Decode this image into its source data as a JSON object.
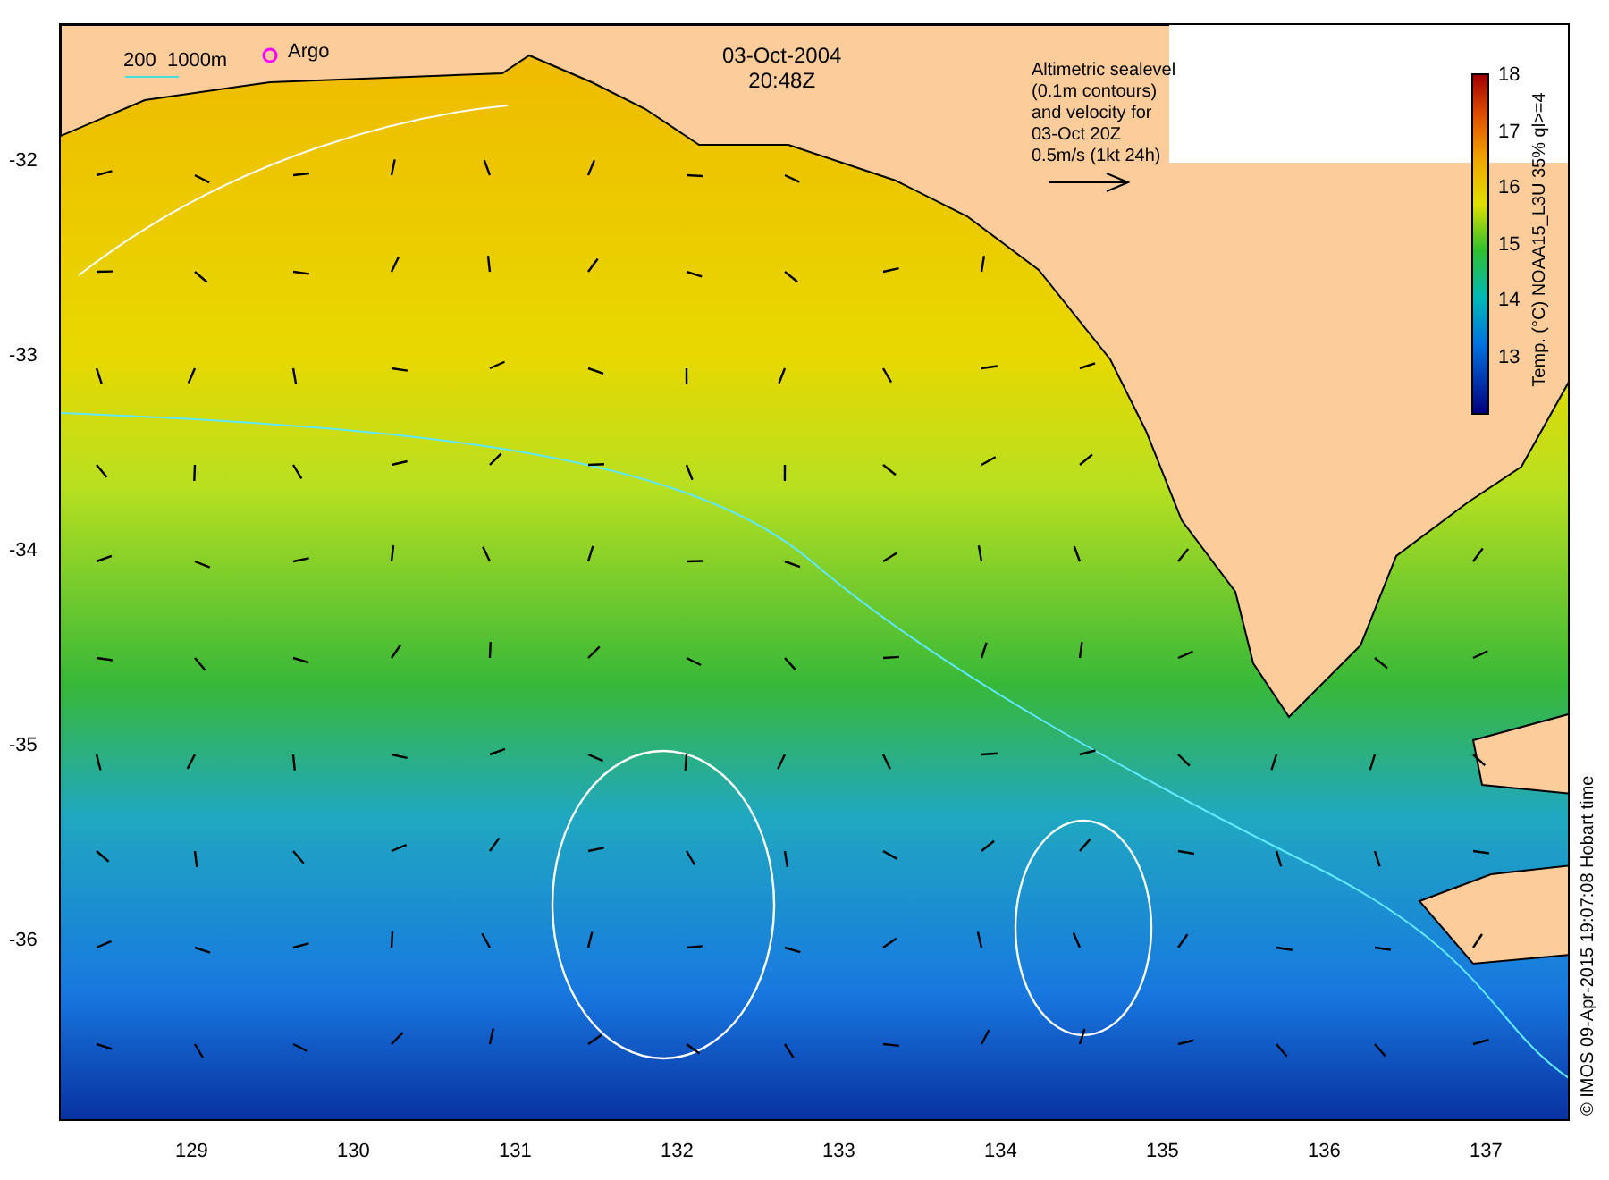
{
  "map": {
    "date": "03-Oct-2004",
    "time": "20:48Z",
    "scale_label": "200  1000m",
    "argo_label": "Argo",
    "legend": [
      "Altimetric sealevel",
      "(0.1m contours)",
      "and velocity for",
      "03-Oct 20Z",
      "0.5m/s (1kt 24h)"
    ]
  },
  "colorbar": {
    "title": "Temp. (°C) NOAA15_L3U 35% ql>=4",
    "ticks": [
      "18",
      "17",
      "16",
      "15",
      "14",
      "13"
    ]
  },
  "y_axis": [
    "-32",
    "-33",
    "-34",
    "-35",
    "-36"
  ],
  "x_axis": [
    "129",
    "130",
    "131",
    "132",
    "133",
    "134",
    "135",
    "136",
    "137"
  ],
  "credit": "© IMOS 09-Apr-2015 19:07:08 Hobart time"
}
